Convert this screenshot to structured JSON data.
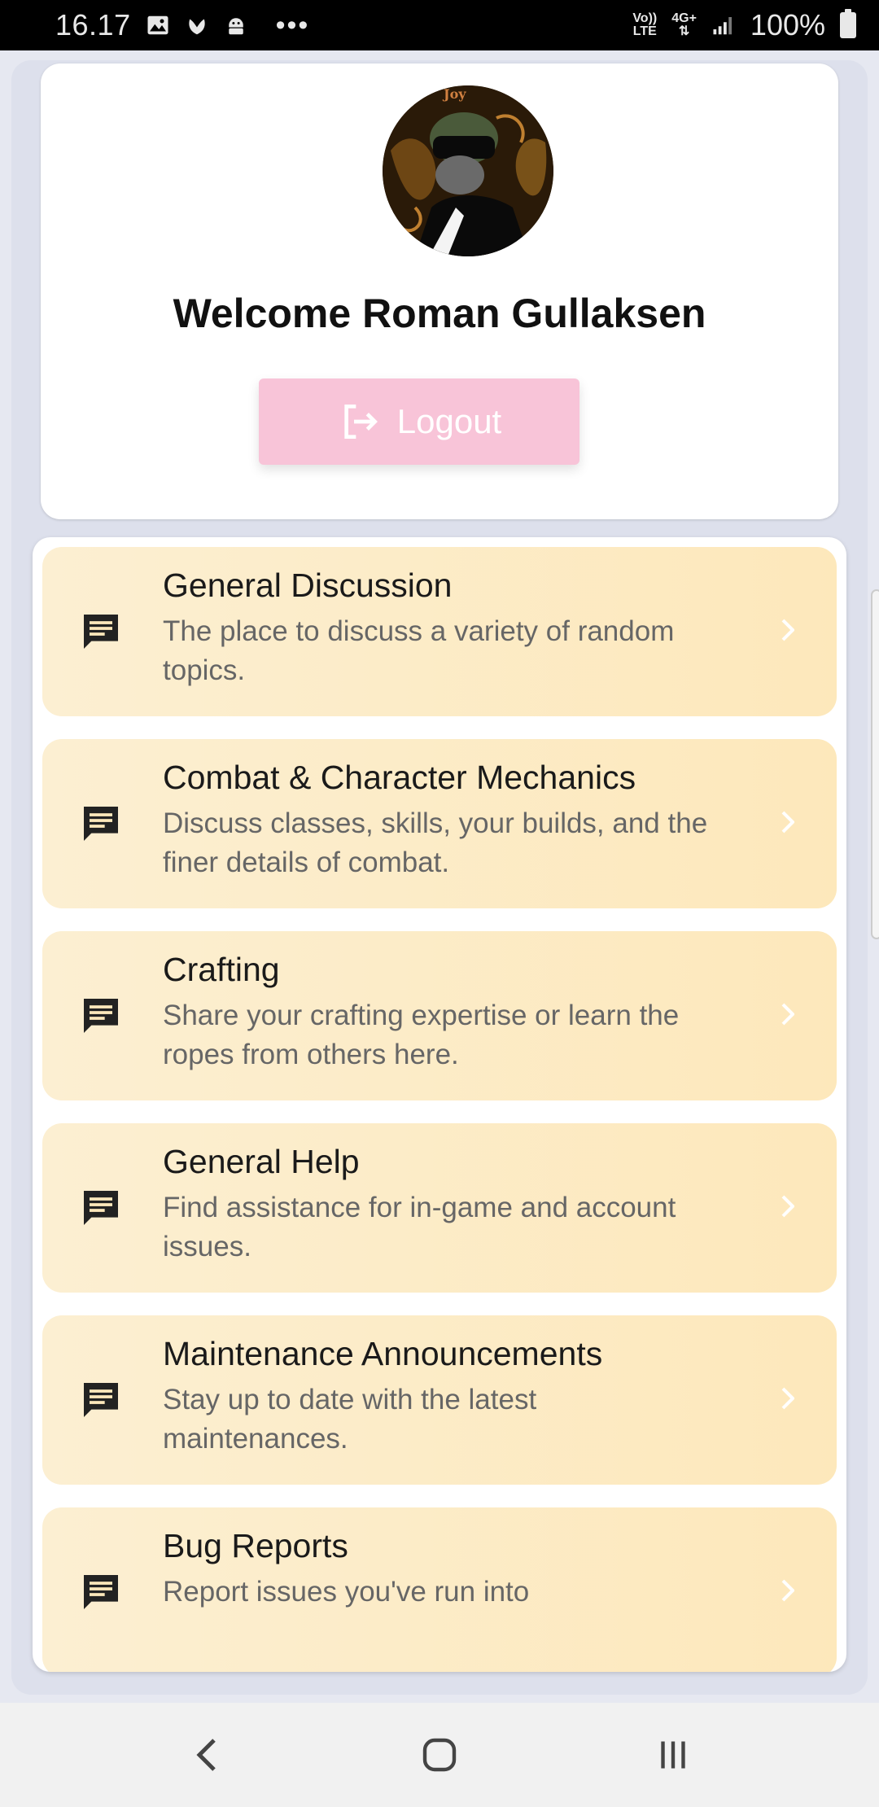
{
  "status_bar": {
    "time": "16.17",
    "icons": [
      "image-icon",
      "leaf-icon",
      "android-icon"
    ],
    "dots": "•••",
    "volte_top": "Vo))",
    "volte_bottom": "LTE",
    "network_top": "4G+",
    "network_bottom": "⇅",
    "battery_percent": "100%"
  },
  "profile": {
    "welcome_text": "Welcome Roman Gullaksen",
    "logout_label": "Logout",
    "avatar_label": "Joy"
  },
  "forums": [
    {
      "title": "General Discussion",
      "description": "The place to discuss a variety of random topics."
    },
    {
      "title": "Combat & Character Mechanics",
      "description": "Discuss classes, skills, your builds, and the finer details of combat."
    },
    {
      "title": "Crafting",
      "description": "Share your crafting expertise or learn the ropes from others here."
    },
    {
      "title": "General Help",
      "description": "Find assistance for in-game and account issues."
    },
    {
      "title": "Maintenance Announcements",
      "description": "Stay up to date with the latest maintenances."
    },
    {
      "title": "Bug Reports",
      "description": "Report issues you've run into"
    }
  ],
  "colors": {
    "logout_bg": "#f8c4d8",
    "forum_bg": "#fde8bb",
    "accent_text": "#1a1a1a"
  },
  "nav": {
    "back": "back-icon",
    "home": "home-icon",
    "recents": "recents-icon"
  }
}
